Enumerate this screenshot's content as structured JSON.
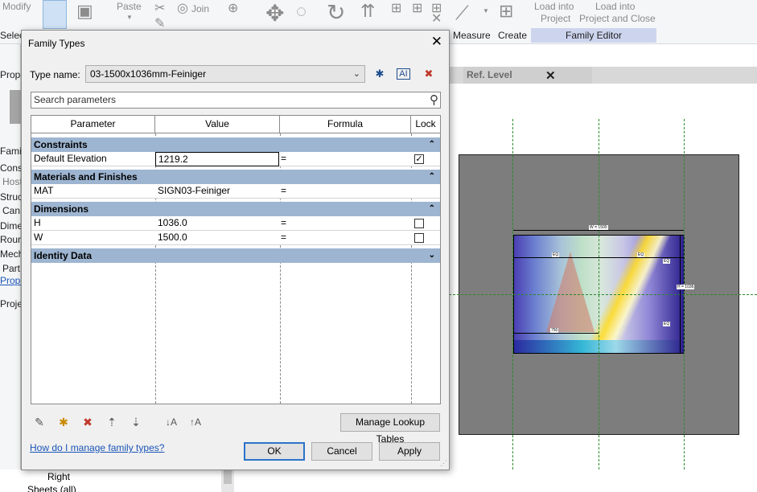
{
  "ribbon": {
    "labels": {
      "modify": "Modify",
      "select": "Selec",
      "paste": "Paste",
      "join": "Join",
      "measure": "Measure",
      "create": "Create",
      "load_project": "Load into\nProject",
      "load_project_line1": "Load into",
      "load_project_line2": "Project",
      "load_close_line1": "Load into",
      "load_close_line2": "Project and Close",
      "family_editor": "Family Editor"
    }
  },
  "left_panel": {
    "items": [
      "Prope",
      "Famil",
      "Const",
      "Host",
      "Struct",
      "Can",
      "Dimer",
      "Rour",
      "Mech",
      "Part",
      "Prope",
      "Projec",
      "Right",
      "Sheets (all)"
    ]
  },
  "view_tab": {
    "label": "Ref. Level",
    "close": "✕"
  },
  "canvas": {
    "dim_overall_width": "W = 1500",
    "dim_left": "EQ",
    "dim_right": "EQ",
    "dim_bottom": "750",
    "dim_height": "H = 1036",
    "dim_eq_top": "EQ",
    "dim_eq_bottom": "EQ"
  },
  "dialog": {
    "title": "Family Types",
    "close": "✕",
    "type_name_label": "Type name:",
    "type_name_value": "03-1500x1036mm-Feiniger",
    "search_placeholder": "Search parameters",
    "columns": [
      "Parameter",
      "Value",
      "Formula",
      "Lock"
    ],
    "groups": [
      {
        "name": "Constraints",
        "chevron": "⌃",
        "rows": [
          {
            "param": "Default Elevation",
            "value": "1219.2",
            "formula": "=",
            "lock": true
          }
        ]
      },
      {
        "name": "Materials and Finishes",
        "chevron": "⌃",
        "rows": [
          {
            "param": "MAT",
            "value": "SIGN03-Feiniger",
            "formula": "=",
            "lock": null
          }
        ]
      },
      {
        "name": "Dimensions",
        "chevron": "⌃",
        "rows": [
          {
            "param": "H",
            "value": "1036.0",
            "formula": "=",
            "lock": false
          },
          {
            "param": "W",
            "value": "1500.0",
            "formula": "=",
            "lock": false
          }
        ]
      },
      {
        "name": "Identity Data",
        "chevron": "⌄",
        "rows": []
      }
    ],
    "buttons": {
      "manage_lookup": "Manage Lookup Tables",
      "ok": "OK",
      "cancel": "Cancel",
      "apply": "Apply"
    },
    "help_link": "How do I manage family types?"
  }
}
